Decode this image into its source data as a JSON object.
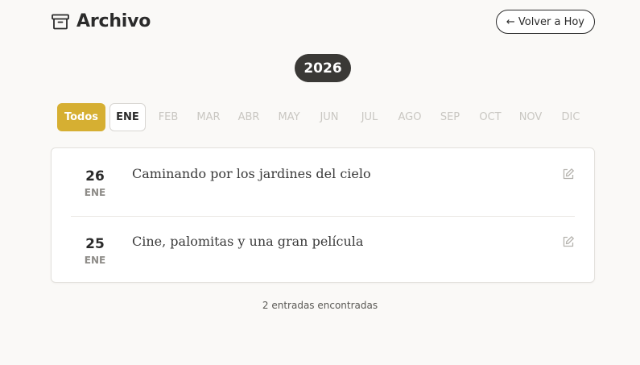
{
  "header": {
    "title": "Archivo",
    "icon": "archive-box-icon",
    "back_label": "← Volver a Hoy"
  },
  "year": "2026",
  "filters": {
    "all_label": "Todos",
    "active_month": "ENE",
    "months": [
      "FEB",
      "MAR",
      "ABR",
      "MAY",
      "JUN",
      "JUL",
      "AGO",
      "SEP",
      "OCT",
      "NOV",
      "DIC"
    ]
  },
  "entries": [
    {
      "day": "26",
      "month": "ENE",
      "title": "Caminando por los jardines del cielo"
    },
    {
      "day": "25",
      "month": "ENE",
      "title": "Cine, palomitas y una gran película"
    }
  ],
  "footer": {
    "count_text": "2 entradas encontradas"
  },
  "colors": {
    "accent": "#d6af32",
    "year_pill": "#3a3936",
    "background": "#faf9f7"
  }
}
